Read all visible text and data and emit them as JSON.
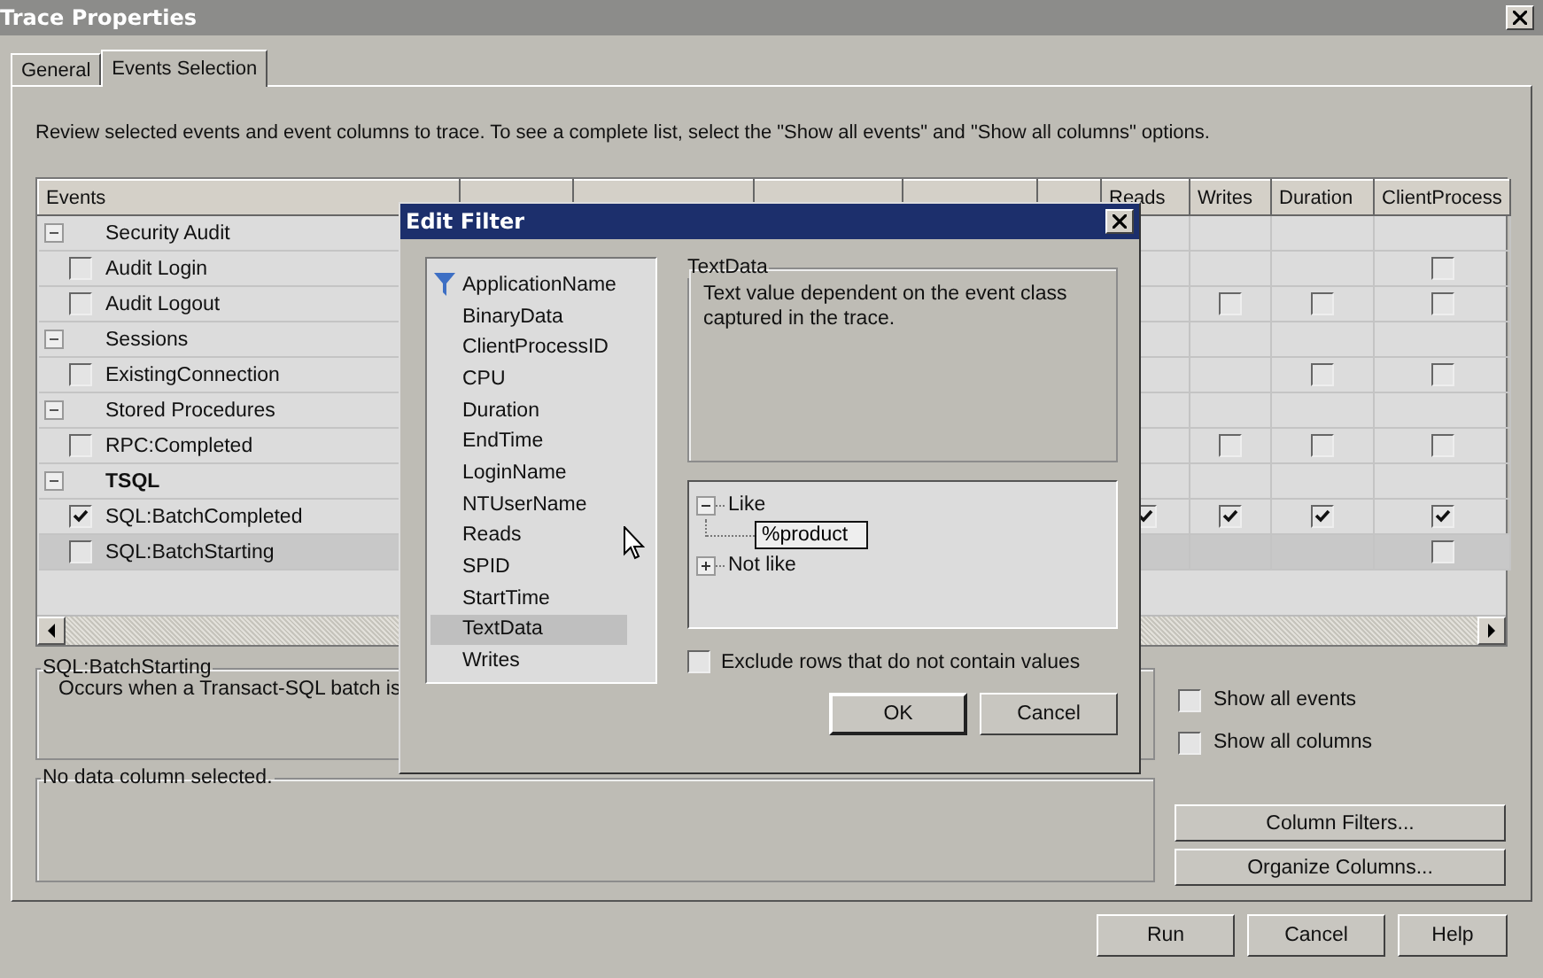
{
  "window": {
    "title": "Trace Properties"
  },
  "tabs": [
    {
      "label": "General",
      "selected": false
    },
    {
      "label": "Events Selection",
      "selected": true
    }
  ],
  "instructions": "Review selected events and event columns to trace. To see a complete list, select the \"Show all events\" and \"Show all columns\" options.",
  "grid": {
    "columns": [
      {
        "label": "Events"
      },
      {
        "label": "Reads"
      },
      {
        "label": "Writes"
      },
      {
        "label": "Duration"
      },
      {
        "label": "ClientProcess"
      }
    ],
    "rows": [
      {
        "kind": "category",
        "label": "Security Audit",
        "expanded": true,
        "emphasized": false,
        "selected": false
      },
      {
        "kind": "event",
        "label": "Audit Login",
        "checked": false,
        "selected": false,
        "cells": [
          {
            "kind": "empty"
          },
          {
            "kind": "empty"
          },
          {
            "kind": "empty"
          },
          {
            "kind": "checkbox",
            "checked": false
          }
        ]
      },
      {
        "kind": "event",
        "label": "Audit Logout",
        "checked": false,
        "selected": false,
        "cells": [
          {
            "kind": "empty"
          },
          {
            "kind": "checkbox",
            "checked": false
          },
          {
            "kind": "checkbox",
            "checked": false
          },
          {
            "kind": "checkbox",
            "checked": false
          }
        ]
      },
      {
        "kind": "category",
        "label": "Sessions",
        "expanded": true,
        "emphasized": false,
        "selected": false
      },
      {
        "kind": "event",
        "label": "ExistingConnection",
        "checked": false,
        "selected": false,
        "cells": [
          {
            "kind": "empty"
          },
          {
            "kind": "empty"
          },
          {
            "kind": "checkbox",
            "checked": false
          },
          {
            "kind": "checkbox",
            "checked": false
          }
        ]
      },
      {
        "kind": "category",
        "label": "Stored Procedures",
        "expanded": true,
        "emphasized": false,
        "selected": false
      },
      {
        "kind": "event",
        "label": "RPC:Completed",
        "checked": false,
        "selected": false,
        "cells": [
          {
            "kind": "empty"
          },
          {
            "kind": "checkbox",
            "checked": false
          },
          {
            "kind": "checkbox",
            "checked": false
          },
          {
            "kind": "checkbox",
            "checked": false
          }
        ]
      },
      {
        "kind": "category",
        "label": "TSQL",
        "expanded": true,
        "emphasized": true,
        "selected": false
      },
      {
        "kind": "event",
        "label": "SQL:BatchCompleted",
        "checked": true,
        "selected": false,
        "cells": [
          {
            "kind": "checkbox",
            "checked": true
          },
          {
            "kind": "checkbox",
            "checked": true
          },
          {
            "kind": "checkbox",
            "checked": true
          },
          {
            "kind": "checkbox",
            "checked": true
          }
        ]
      },
      {
        "kind": "event",
        "label": "SQL:BatchStarting",
        "checked": false,
        "selected": true,
        "cells": [
          {
            "kind": "empty"
          },
          {
            "kind": "empty"
          },
          {
            "kind": "empty"
          },
          {
            "kind": "checkbox",
            "checked": false
          }
        ]
      }
    ]
  },
  "event_description": {
    "title": "SQL:BatchStarting",
    "text": "Occurs when a Transact-SQL batch is"
  },
  "column_description": {
    "title": "No data column selected."
  },
  "options": [
    {
      "label": "Show all events",
      "checked": false
    },
    {
      "label": "Show all columns",
      "checked": false
    }
  ],
  "side_buttons": [
    "Column Filters...",
    "Organize Columns..."
  ],
  "buttons": [
    "Run",
    "Cancel",
    "Help"
  ],
  "dialog": {
    "title": "Edit Filter",
    "fields": [
      {
        "label": "ApplicationName",
        "filtered": true,
        "selected": false
      },
      {
        "label": "BinaryData",
        "filtered": false,
        "selected": false
      },
      {
        "label": "ClientProcessID",
        "filtered": false,
        "selected": false
      },
      {
        "label": "CPU",
        "filtered": false,
        "selected": false
      },
      {
        "label": "Duration",
        "filtered": false,
        "selected": false
      },
      {
        "label": "EndTime",
        "filtered": false,
        "selected": false
      },
      {
        "label": "LoginName",
        "filtered": false,
        "selected": false
      },
      {
        "label": "NTUserName",
        "filtered": false,
        "selected": false
      },
      {
        "label": "Reads",
        "filtered": false,
        "selected": false
      },
      {
        "label": "SPID",
        "filtered": false,
        "selected": false
      },
      {
        "label": "StartTime",
        "filtered": false,
        "selected": false
      },
      {
        "label": "TextData",
        "filtered": false,
        "selected": true
      },
      {
        "label": "Writes",
        "filtered": false,
        "selected": false
      }
    ],
    "field_info": {
      "title": "TextData",
      "text": "Text value dependent on the event class captured in the trace."
    },
    "operators": [
      {
        "label": "Like",
        "expanded": true,
        "children": [
          {
            "kind": "input",
            "value": "%product"
          }
        ]
      },
      {
        "label": "Not like",
        "expanded": false
      }
    ],
    "exclude": {
      "label": "Exclude rows that do not contain values",
      "checked": false
    },
    "buttons": [
      "OK",
      "Cancel"
    ]
  }
}
